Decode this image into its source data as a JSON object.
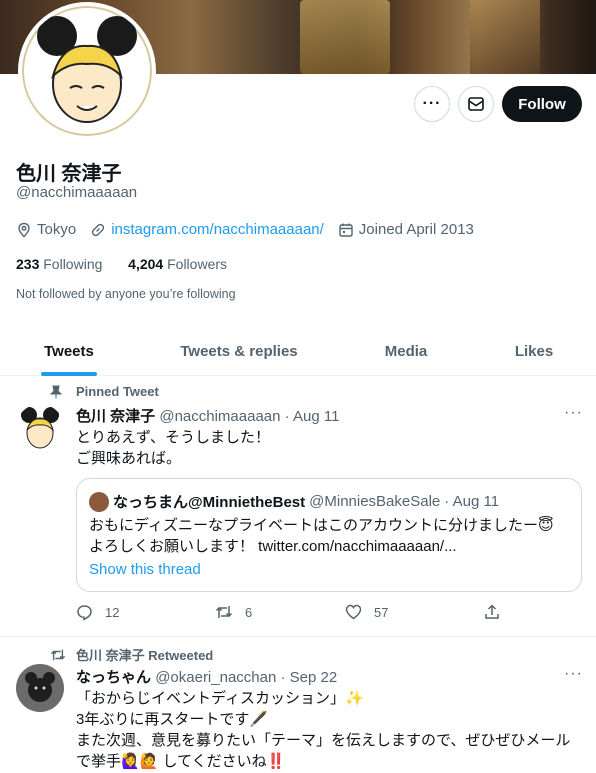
{
  "profile": {
    "name": "色川 奈津子",
    "handle": "@nacchimaaaaan",
    "location": "Tokyo",
    "website": "instagram.com/nacchimaaaaan/",
    "joined": "Joined April 2013",
    "following_count": "233",
    "following_label": "Following",
    "followers_count": "4,204",
    "followers_label": "Followers",
    "not_followed": "Not followed by anyone you’re following"
  },
  "actions": {
    "more": "···",
    "follow": "Follow"
  },
  "tabs": [
    "Tweets",
    "Tweets & replies",
    "Media",
    "Likes"
  ],
  "tweets": [
    {
      "context": "Pinned Tweet",
      "name": "色川 奈津子",
      "handle": "@nacchimaaaaan",
      "time": "· Aug 11",
      "text_line1": "とりあえず、そうしました！",
      "text_line2": "ご興味あれば。",
      "quote": {
        "name": "なっちまん@MinnietheBest",
        "handle": "@MinniesBakeSale",
        "time": "· Aug 11",
        "text_line1": "おもにディズニーなプライベートはこのアカウントに分けましたー😇",
        "text_line2": "よろしくお願いします！ twitter.com/nacchimaaaaan/...",
        "show_thread": "Show this thread"
      },
      "replies": "12",
      "retweets": "6",
      "likes": "57"
    },
    {
      "context": "色川 奈津子 Retweeted",
      "name": "なっちゃん",
      "handle": "@okaeri_nacchan",
      "time": "· Sep 22",
      "text_line1": "「おからじイベントディスカッション」✨",
      "text_line2": "3年ぶりに再スタートです🖋️",
      "text_line3": "また次週、意見を募りたい「テーマ」を伝えしますので、ぜひぜひメール",
      "text_line4": "で挙手🙋‍♀️🙋 してくださいね‼️"
    }
  ]
}
